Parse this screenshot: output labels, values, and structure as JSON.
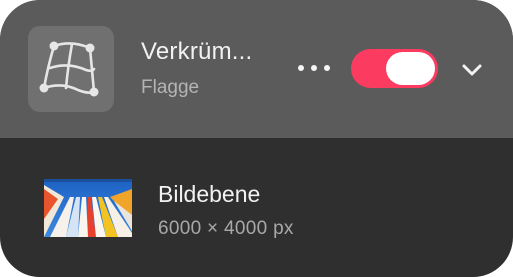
{
  "effect": {
    "title": "Verkrüm...",
    "subtitle": "Flagge",
    "icon": "warp-flag-icon",
    "enabled": true,
    "toggle_color": "#fb3b5f",
    "more_icon": "more-dots-icon",
    "collapse_icon": "chevron-down-icon"
  },
  "layer": {
    "name": "Bildebene",
    "size": "6000 × 4000 px",
    "thumbnail": "image-thumbnail"
  }
}
